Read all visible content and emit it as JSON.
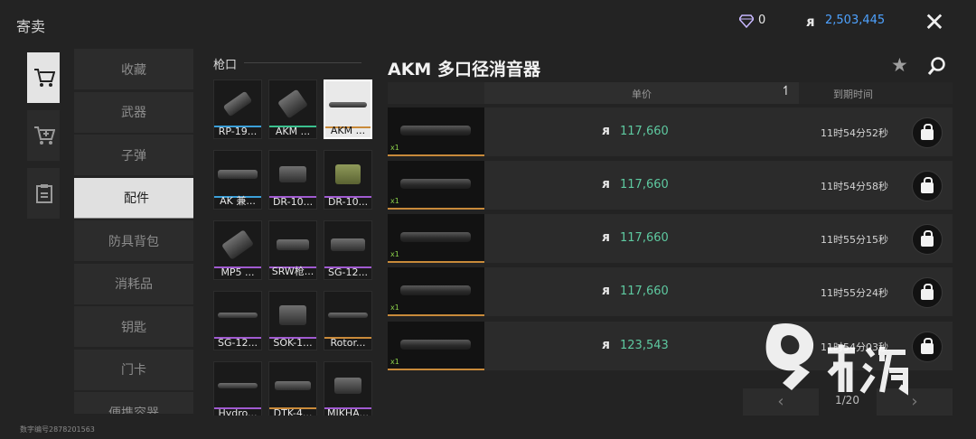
{
  "header": {
    "title": "寄卖",
    "gem_count": "0",
    "coin_amount": "2,503,445",
    "coin_symbol": "ᴙ",
    "close_label": "✕"
  },
  "side_tabs": [
    {
      "name": "market",
      "icon": "cart-icon"
    },
    {
      "name": "sell",
      "icon": "cart-add-icon"
    },
    {
      "name": "list",
      "icon": "clipboard-icon"
    }
  ],
  "categories": [
    "收藏",
    "武器",
    "子弹",
    "配件",
    "防具背包",
    "消耗品",
    "钥匙",
    "门卡",
    "便携容器"
  ],
  "active_category": "配件",
  "grid": {
    "section_label": "枪口",
    "items": [
      {
        "label": "RP-19...",
        "rarity": "#3b9fd8"
      },
      {
        "label": "AKM ...",
        "rarity": "#3bc08f"
      },
      {
        "label": "AKM ...",
        "rarity": "#c98a3a",
        "selected": true
      },
      {
        "label": "AK 兼...",
        "rarity": "#3b9fd8"
      },
      {
        "label": "DR-10...",
        "rarity": "#a05ad0"
      },
      {
        "label": "DR-10...",
        "rarity": "#a05ad0"
      },
      {
        "label": "MP5 ...",
        "rarity": "#a05ad0"
      },
      {
        "label": "SRW枪...",
        "rarity": "#a05ad0"
      },
      {
        "label": "SG-12...",
        "rarity": "#a05ad0"
      },
      {
        "label": "SG-12...",
        "rarity": "#a05ad0"
      },
      {
        "label": "SOK-1...",
        "rarity": "#a05ad0"
      },
      {
        "label": "Rotor...",
        "rarity": "#c98a3a"
      },
      {
        "label": "Hydro...",
        "rarity": "#a05ad0"
      },
      {
        "label": "DTK-4...",
        "rarity": "#c98a3a"
      },
      {
        "label": "MIKHA...",
        "rarity": "#a05ad0"
      }
    ]
  },
  "detail": {
    "title": "AKM 多口径消音器",
    "col_price": "单价",
    "col_expire": "到期时间",
    "sort_icon": "↿",
    "listings": [
      {
        "price": "117,660",
        "expire": "11时54分52秒",
        "tag": "x1"
      },
      {
        "price": "117,660",
        "expire": "11时54分58秒",
        "tag": "x1"
      },
      {
        "price": "117,660",
        "expire": "11时55分15秒",
        "tag": "x1"
      },
      {
        "price": "117,660",
        "expire": "11时55分24秒",
        "tag": "x1"
      },
      {
        "price": "123,543",
        "expire": "11时54分03秒",
        "tag": "x1"
      }
    ]
  },
  "pager": {
    "label": "1/20",
    "prev": "‹",
    "next": "›"
  },
  "footer": {
    "id_text": "数字编号2878201563"
  },
  "colors": {
    "accent_price": "#5ec9a0",
    "coin_blue": "#4ea2ff",
    "rarity_gold": "#c88a3a"
  }
}
